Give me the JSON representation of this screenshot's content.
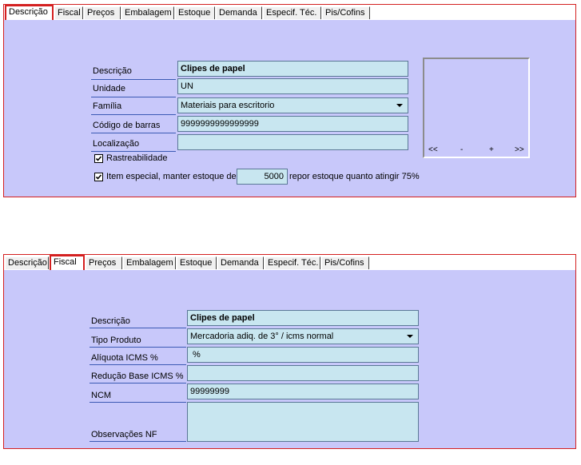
{
  "tabs": [
    "Descrição",
    "Fiscal",
    "Preços",
    "Embalagem",
    "Estoque",
    "Demanda",
    "Especif. Téc.",
    "Pis/Cofins"
  ],
  "panel1": {
    "active_tab": "Descrição",
    "fields": {
      "descricao": {
        "label": "Descrição",
        "value": "Clipes de papel"
      },
      "unidade": {
        "label": "Unidade",
        "value": "UN"
      },
      "familia": {
        "label": "Família",
        "value": "Materiais para escritorio"
      },
      "codigo_barras": {
        "label": "Código de barras",
        "value": "9999999999999999"
      },
      "localizacao": {
        "label": "Localização",
        "value": ""
      }
    },
    "rastreabilidade": {
      "label": "Rastreabilidade",
      "checked": true
    },
    "item_especial": {
      "label_before": "Item especial, manter estoque de",
      "value": "5000",
      "label_after": "repor estoque quanto atingir 75%",
      "checked": true
    },
    "image_nav": {
      "first": "<<",
      "minus": "-",
      "plus": "+",
      "last": ">>"
    }
  },
  "panel2": {
    "active_tab": "Fiscal",
    "fields": {
      "descricao": {
        "label": "Descrição",
        "value": "Clipes de papel"
      },
      "tipo_produto": {
        "label": "Tipo Produto",
        "value": "Mercadoria adiq. de 3° / icms normal"
      },
      "aliquota": {
        "label": "Alíquota ICMS %",
        "value": " %"
      },
      "reducao": {
        "label": "Redução Base ICMS %",
        "value": ""
      },
      "ncm": {
        "label": "NCM",
        "value": "99999999"
      },
      "observacoes": {
        "label": "Observações NF",
        "value": ""
      }
    }
  },
  "colors": {
    "panel_bg": "#c8c8fa",
    "field_bg": "#c8e6f0",
    "active_border": "#d42020"
  }
}
